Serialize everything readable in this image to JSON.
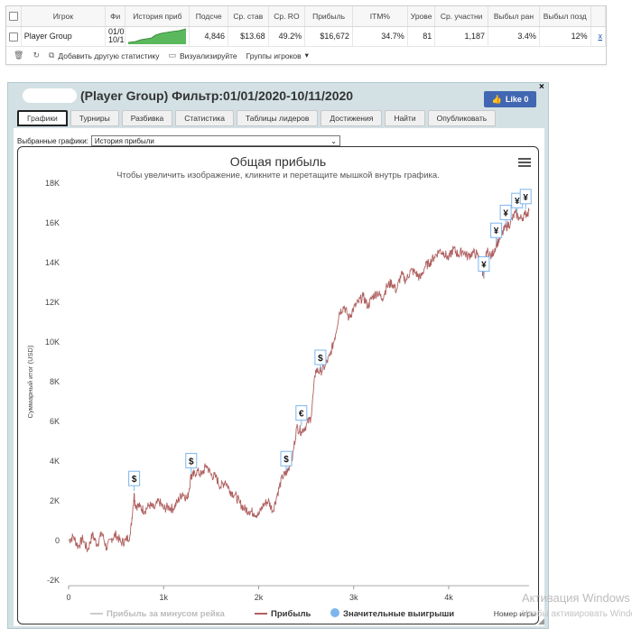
{
  "stats_table": {
    "columns": [
      "",
      "Игрок",
      "Фи",
      "История приб",
      "Подсче",
      "Ср. став",
      "Ср. RO",
      "Прибыль",
      "ITM%",
      "Урове",
      "Ср. участни",
      "Выбыл ран",
      "Выбыл позд",
      ""
    ],
    "row": {
      "player": "Player Group",
      "filter_line1": "01/0",
      "filter_line2": "10/1",
      "count": "4,846",
      "avg_stake": "$13.68",
      "avg_roi": "49.2%",
      "profit": "$16,672",
      "itm": "34.7%",
      "level": "81",
      "avg_entrants": "1,187",
      "early_out": "3.4%",
      "late_out": "12%",
      "remove": "x"
    },
    "toolbar": {
      "add_stat": "Добавить другую статистику",
      "visualize": "Визуализируйте",
      "groups": "Группы игроков"
    }
  },
  "window": {
    "title": "(Player Group) Фильтр:01/01/2020-10/11/2020",
    "like_label": "Like 0",
    "close": "×",
    "tabs": [
      "Графики",
      "Турниры",
      "Разбивка",
      "Статистика",
      "Таблицы лидеров",
      "Достижения",
      "Найти",
      "Опубликовать"
    ],
    "active_tab": 0,
    "selected_label": "Выбранные графики:",
    "selected_value": "История прибыли"
  },
  "chart_data": {
    "type": "line",
    "title": "Общая прибыль",
    "subtitle": "Чтобы увеличить изображение, кликните и перетащите мышкой внутрь графика.",
    "ylabel": "Суммарный итог (USD)",
    "xlabel": "Номер игры",
    "ylim": [
      -2000,
      18000
    ],
    "xlim": [
      0,
      4846
    ],
    "y_ticks": [
      "-2K",
      "0",
      "2K",
      "4K",
      "6K",
      "8K",
      "10K",
      "12K",
      "14K",
      "16K",
      "18K"
    ],
    "x_ticks": [
      "0",
      "1k",
      "2k",
      "3k",
      "4k"
    ],
    "x_tick_values": [
      0,
      1000,
      2000,
      3000,
      4000
    ],
    "y_tick_values": [
      -2000,
      0,
      2000,
      4000,
      6000,
      8000,
      10000,
      12000,
      14000,
      16000,
      18000
    ],
    "series": [
      {
        "name": "Прибыль за минусом рейка",
        "color": "#cccccc",
        "values": []
      },
      {
        "name": "Прибыль",
        "color": "#b06060",
        "x": [
          0,
          50,
          100,
          150,
          200,
          250,
          300,
          350,
          400,
          450,
          500,
          550,
          600,
          650,
          690,
          700,
          750,
          800,
          850,
          900,
          950,
          1000,
          1050,
          1100,
          1150,
          1200,
          1250,
          1290,
          1300,
          1350,
          1400,
          1450,
          1500,
          1550,
          1600,
          1650,
          1700,
          1750,
          1800,
          1850,
          1900,
          1950,
          2000,
          2050,
          2100,
          2150,
          2200,
          2250,
          2290,
          2300,
          2350,
          2400,
          2450,
          2500,
          2550,
          2600,
          2650,
          2700,
          2750,
          2800,
          2850,
          2900,
          2950,
          3000,
          3050,
          3100,
          3150,
          3200,
          3250,
          3300,
          3350,
          3400,
          3450,
          3500,
          3550,
          3600,
          3650,
          3700,
          3750,
          3800,
          3850,
          3900,
          3950,
          4000,
          4050,
          4100,
          4150,
          4200,
          4250,
          4300,
          4350,
          4370,
          4400,
          4450,
          4500,
          4550,
          4600,
          4650,
          4700,
          4750,
          4800,
          4846
        ],
        "values": [
          0,
          200,
          -300,
          100,
          -500,
          300,
          -200,
          400,
          -400,
          100,
          300,
          -100,
          0,
          300,
          2400,
          1800,
          1700,
          1500,
          1800,
          1600,
          2000,
          1600,
          1700,
          1600,
          2000,
          2400,
          2100,
          3300,
          3200,
          3500,
          3300,
          3800,
          3300,
          3200,
          2700,
          3000,
          2500,
          2300,
          1900,
          1600,
          1500,
          1400,
          1300,
          1800,
          2000,
          1500,
          2400,
          3200,
          3400,
          3600,
          4000,
          5700,
          5500,
          5800,
          6200,
          8600,
          8500,
          8800,
          9300,
          10200,
          11500,
          11800,
          11200,
          11700,
          12000,
          12300,
          11800,
          12300,
          12500,
          12200,
          12800,
          13000,
          12600,
          13400,
          13100,
          13600,
          13500,
          13200,
          13800,
          14000,
          14300,
          14600,
          14500,
          14200,
          14700,
          14400,
          14600,
          14300,
          14500,
          14400,
          13800,
          13200,
          14600,
          14300,
          14900,
          15300,
          15800,
          16000,
          16500,
          16200,
          16400,
          16600
        ]
      },
      {
        "name": "Значительные выигрыши",
        "color": "#7cb5ec",
        "values": []
      }
    ],
    "markers": [
      {
        "x": 690,
        "y": 2400,
        "label": "$"
      },
      {
        "x": 1290,
        "y": 3300,
        "label": "$"
      },
      {
        "x": 2290,
        "y": 3400,
        "label": "$"
      },
      {
        "x": 2450,
        "y": 5700,
        "label": "€"
      },
      {
        "x": 2650,
        "y": 8500,
        "label": "$"
      },
      {
        "x": 4370,
        "y": 13200,
        "label": "¥"
      },
      {
        "x": 4500,
        "y": 14900,
        "label": "¥"
      },
      {
        "x": 4600,
        "y": 15800,
        "label": "¥"
      },
      {
        "x": 4720,
        "y": 16400,
        "label": "¥"
      },
      {
        "x": 4810,
        "y": 16600,
        "label": "¥"
      }
    ],
    "legend_placement": "bottom-center",
    "grid": false
  },
  "os_watermark": {
    "line1": "Активация Windows",
    "line2": "Чтобы активировать Windows"
  }
}
